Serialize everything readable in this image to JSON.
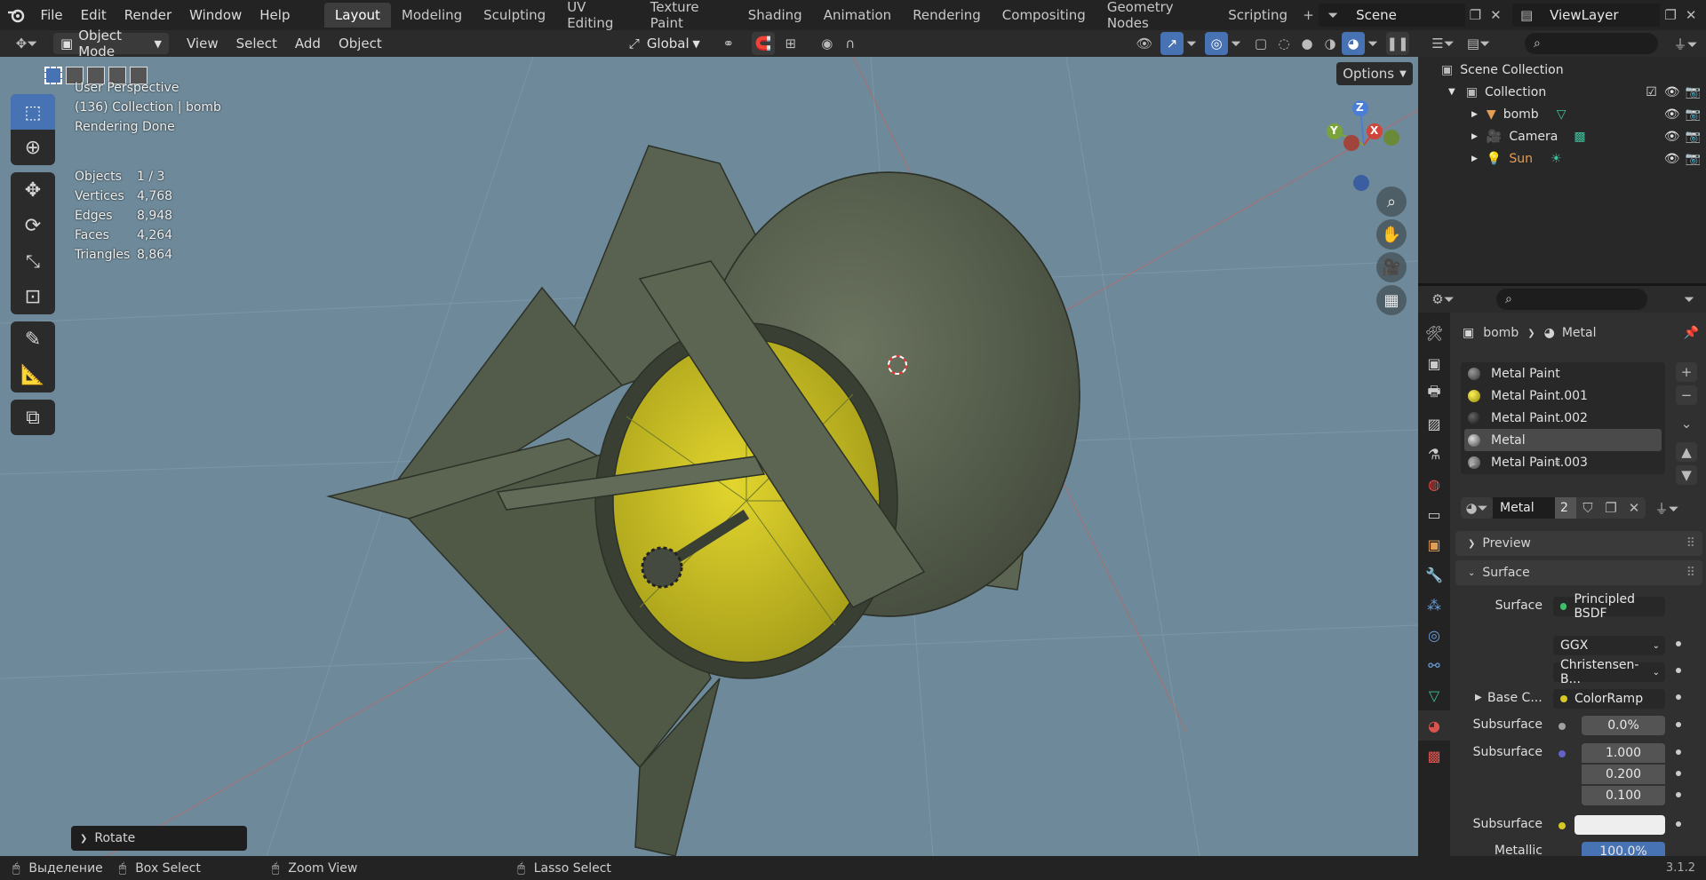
{
  "top_menu": [
    "File",
    "Edit",
    "Render",
    "Window",
    "Help"
  ],
  "workspaces": [
    "Layout",
    "Modeling",
    "Sculpting",
    "UV Editing",
    "Texture Paint",
    "Shading",
    "Animation",
    "Rendering",
    "Compositing",
    "Geometry Nodes",
    "Scripting"
  ],
  "active_workspace": "Layout",
  "scene_name": "Scene",
  "view_layer": "ViewLayer",
  "header": {
    "mode": "Object Mode",
    "menus": [
      "View",
      "Select",
      "Add",
      "Object"
    ],
    "transform_orientation": "Global",
    "options_label": "Options"
  },
  "viewport": {
    "info": [
      "User Perspective",
      "(136) Collection | bomb",
      "Rendering Done"
    ],
    "stats": [
      {
        "label": "Objects",
        "value": "1 / 3"
      },
      {
        "label": "Vertices",
        "value": "4,768"
      },
      {
        "label": "Edges",
        "value": "8,948"
      },
      {
        "label": "Faces",
        "value": "4,264"
      },
      {
        "label": "Triangles",
        "value": "8,864"
      }
    ],
    "gizmo_axes": [
      "Z",
      "Y",
      "X"
    ],
    "last_operator": "Rotate",
    "background_color": "#6e8a9a",
    "mesh_color": "#5c6452",
    "cap_color": "#d6c925"
  },
  "outliner": {
    "root": "Scene Collection",
    "collection": "Collection",
    "items": [
      "bomb",
      "Camera",
      "Sun"
    ]
  },
  "properties": {
    "breadcrumb_object": "bomb",
    "breadcrumb_material": "Metal",
    "slots": [
      "Metal Paint",
      "Metal Paint.001",
      "Metal Paint.002",
      "Metal",
      "Metal Paint.003"
    ],
    "active_slot": "Metal",
    "material_name": "Metal",
    "user_count": "2",
    "panel_preview": "Preview",
    "panel_surface": "Surface",
    "surface_label": "Surface",
    "surface_value": "Principled BSDF",
    "distribution": "GGX",
    "subsurface_method": "Christensen-B...",
    "base_color_label": "Base C...",
    "base_color_value": "ColorRamp",
    "subsurface_label": "Subsurface",
    "subsurface_value": "0.0%",
    "subsurface_radius_label": "Subsurface",
    "subsurface_radius": [
      "1.000",
      "0.200",
      "0.100"
    ],
    "subsurface_color_label": "Subsurface",
    "metallic_label": "Metallic",
    "metallic_value": "100.0%"
  },
  "status_bar": {
    "select": "Выделение",
    "box_select": "Box Select",
    "zoom_view": "Zoom View",
    "lasso_select": "Lasso Select",
    "version": "3.1.2"
  }
}
